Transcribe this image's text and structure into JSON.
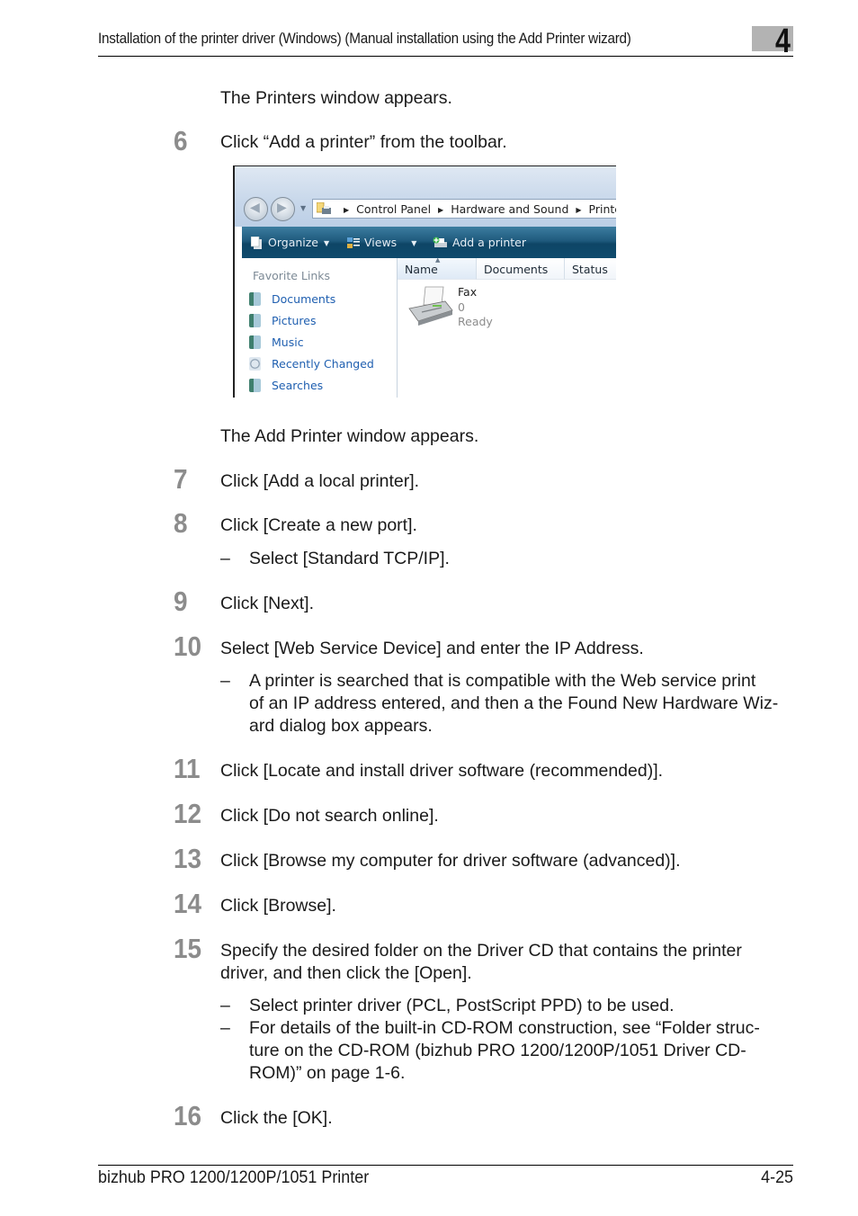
{
  "header": {
    "title": "Installation of the printer driver (Windows) (Manual installation using the Add Printer wizard)",
    "chapter": "4"
  },
  "intro_text": "The Printers window appears.",
  "steps": [
    {
      "number": "6",
      "text": "Click “Add a printer” from the toolbar."
    },
    {
      "number": "7",
      "text": "Click [Add a local printer]."
    },
    {
      "number": "8",
      "text": "Click [Create a new port].",
      "notes": [
        "Select [Standard TCP/IP]."
      ]
    },
    {
      "number": "9",
      "text": "Click [Next]."
    },
    {
      "number": "10",
      "text": "Select [Web Service Device] and enter the IP Address.",
      "notes": [
        "A printer is searched that is compatible with the Web service print",
        "of an IP address entered, and then a the Found New Hardware Wiz-",
        "ard dialog box appears."
      ]
    },
    {
      "number": "11",
      "text": "Click [Locate and install driver software (recommended)]."
    },
    {
      "number": "12",
      "text": "Click [Do not search online]."
    },
    {
      "number": "13",
      "text": "Click [Browse my computer for driver software (advanced)]."
    },
    {
      "number": "14",
      "text": "Click [Browse]."
    },
    {
      "number": "15",
      "text": [
        "Specify the desired folder on the Driver CD that contains the printer",
        "driver, and then click the [Open]."
      ],
      "notes": [
        "Select printer driver (PCL, PostScript PPD) to be used.",
        "For details of the built-in CD-ROM construction, see “Folder struc-",
        "ture on the CD-ROM (bizhub PRO 1200/1200P/1051 Driver CD-",
        "ROM)” on page 1-6."
      ]
    },
    {
      "number": "16",
      "text": "Click the [OK]."
    }
  ],
  "after_screenshot_text": "The Add Printer window appears.",
  "note_dash": "–",
  "screenshot": {
    "breadcrumb": [
      "Control Panel",
      "Hardware and Sound",
      "Printers"
    ],
    "toolbar": {
      "organize": "Organize",
      "views": "Views",
      "add_printer": "Add a printer"
    },
    "favorite_links_title": "Favorite Links",
    "favorite_links": [
      "Documents",
      "Pictures",
      "Music",
      "Recently Changed",
      "Searches"
    ],
    "columns": [
      "Name",
      "Documents",
      "Status"
    ],
    "printer": {
      "name": "Fax",
      "documents": "0",
      "status": "Ready"
    }
  },
  "footer": {
    "product": "bizhub PRO 1200/1200P/1051 Printer",
    "page": "4-25"
  }
}
